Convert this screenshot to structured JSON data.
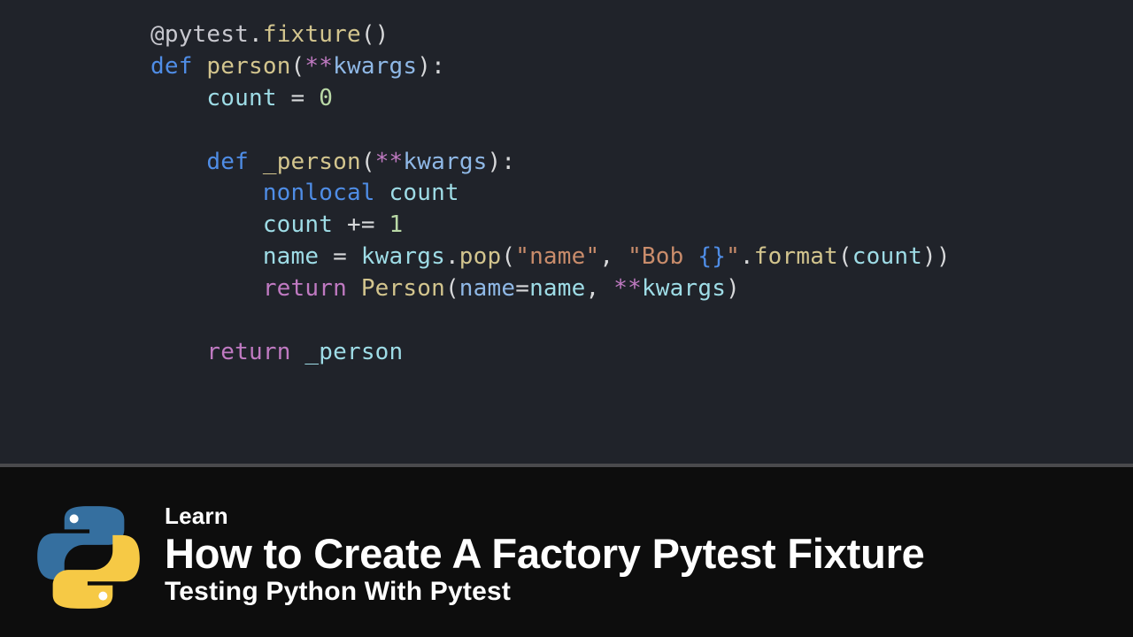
{
  "code": {
    "lines": [
      [
        {
          "t": "@pytest",
          "c": "c-decor"
        },
        {
          "t": ".",
          "c": "c-punc"
        },
        {
          "t": "fixture",
          "c": "c-fn"
        },
        {
          "t": "()",
          "c": "c-punc"
        }
      ],
      [
        {
          "t": "def ",
          "c": "c-key"
        },
        {
          "t": "person",
          "c": "c-fn"
        },
        {
          "t": "(",
          "c": "c-punc"
        },
        {
          "t": "**",
          "c": "c-op"
        },
        {
          "t": "kwargs",
          "c": "c-id"
        },
        {
          "t": "):",
          "c": "c-punc"
        }
      ],
      [
        {
          "t": "    ",
          "c": ""
        },
        {
          "t": "count",
          "c": "c-param"
        },
        {
          "t": " = ",
          "c": "c-punc"
        },
        {
          "t": "0",
          "c": "c-num"
        }
      ],
      [
        {
          "t": " ",
          "c": ""
        }
      ],
      [
        {
          "t": "    ",
          "c": ""
        },
        {
          "t": "def ",
          "c": "c-key"
        },
        {
          "t": "_person",
          "c": "c-fn"
        },
        {
          "t": "(",
          "c": "c-punc"
        },
        {
          "t": "**",
          "c": "c-op"
        },
        {
          "t": "kwargs",
          "c": "c-id"
        },
        {
          "t": "):",
          "c": "c-punc"
        }
      ],
      [
        {
          "t": "        ",
          "c": ""
        },
        {
          "t": "nonlocal ",
          "c": "c-key"
        },
        {
          "t": "count",
          "c": "c-param"
        }
      ],
      [
        {
          "t": "        ",
          "c": ""
        },
        {
          "t": "count",
          "c": "c-param"
        },
        {
          "t": " += ",
          "c": "c-punc"
        },
        {
          "t": "1",
          "c": "c-num"
        }
      ],
      [
        {
          "t": "        ",
          "c": ""
        },
        {
          "t": "name",
          "c": "c-param"
        },
        {
          "t": " = ",
          "c": "c-punc"
        },
        {
          "t": "kwargs",
          "c": "c-param"
        },
        {
          "t": ".",
          "c": "c-punc"
        },
        {
          "t": "pop",
          "c": "c-fn"
        },
        {
          "t": "(",
          "c": "c-punc"
        },
        {
          "t": "\"name\"",
          "c": "c-str"
        },
        {
          "t": ", ",
          "c": "c-punc"
        },
        {
          "t": "\"Bob ",
          "c": "c-str"
        },
        {
          "t": "{}",
          "c": "c-brace"
        },
        {
          "t": "\"",
          "c": "c-str"
        },
        {
          "t": ".",
          "c": "c-punc"
        },
        {
          "t": "format",
          "c": "c-fn"
        },
        {
          "t": "(",
          "c": "c-punc"
        },
        {
          "t": "count",
          "c": "c-param"
        },
        {
          "t": "))",
          "c": "c-punc"
        }
      ],
      [
        {
          "t": "        ",
          "c": ""
        },
        {
          "t": "return ",
          "c": "c-key2"
        },
        {
          "t": "Person",
          "c": "c-fn"
        },
        {
          "t": "(",
          "c": "c-punc"
        },
        {
          "t": "name",
          "c": "c-id"
        },
        {
          "t": "=",
          "c": "c-punc"
        },
        {
          "t": "name",
          "c": "c-param"
        },
        {
          "t": ", ",
          "c": "c-punc"
        },
        {
          "t": "**",
          "c": "c-op"
        },
        {
          "t": "kwargs",
          "c": "c-param"
        },
        {
          "t": ")",
          "c": "c-punc"
        }
      ],
      [
        {
          "t": " ",
          "c": ""
        }
      ],
      [
        {
          "t": "    ",
          "c": ""
        },
        {
          "t": "return ",
          "c": "c-key2"
        },
        {
          "t": "_person",
          "c": "c-param"
        }
      ]
    ]
  },
  "banner": {
    "eyebrow": "Learn",
    "headline": "How to Create A Factory Pytest Fixture",
    "subtitle": "Testing Python With Pytest"
  },
  "colors": {
    "code_bg": "#20232a",
    "lower_bg": "#0d0d0d",
    "divider": "#4a4a4d",
    "py_blue": "#356f9f",
    "py_yellow": "#f6c945"
  }
}
